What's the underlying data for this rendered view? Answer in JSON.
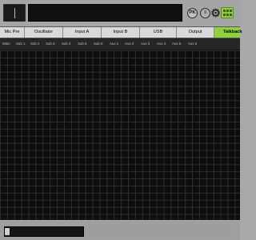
{
  "tabs": [
    {
      "label": "Mic Pre",
      "active": false
    },
    {
      "label": "Oscillator",
      "active": false
    },
    {
      "label": "Input A",
      "active": false
    },
    {
      "label": "Input B",
      "active": false
    },
    {
      "label": "USB",
      "active": false
    },
    {
      "label": "Output",
      "active": false
    },
    {
      "label": "Talkback",
      "active": true
    }
  ],
  "channels": [
    "Main",
    "Sub 1",
    "Sub 2",
    "Sub 3",
    "Sub 4",
    "Sub 5",
    "Sub 6",
    "Aux 1",
    "Aux 2",
    "Aux 3",
    "Aux 4",
    "Aux 5",
    "Aux 6"
  ],
  "header": {
    "lock_icon_label": "PK",
    "icons": [
      "lock-icon",
      "page-icon",
      "gear-icon",
      "grid-icon"
    ]
  },
  "colors": {
    "accent": "#8fd13a",
    "matrix_bg": "#0d0d0d",
    "grid_line": "#2f2f2f"
  }
}
